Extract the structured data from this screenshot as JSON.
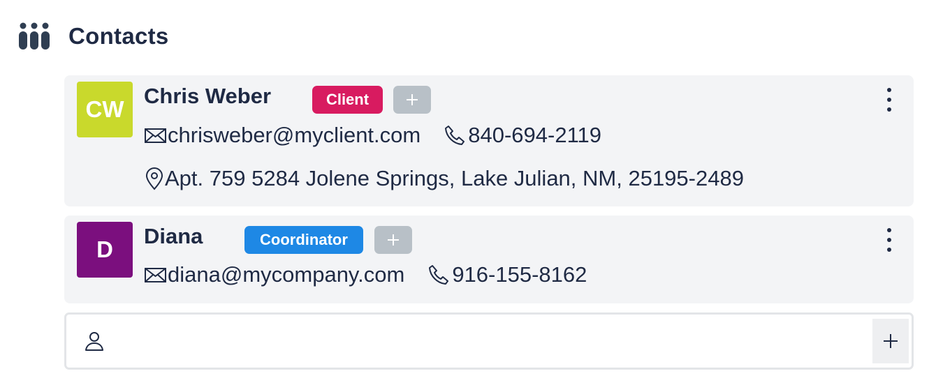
{
  "header": {
    "title": "Contacts",
    "icon": "people-group-icon"
  },
  "contacts": [
    {
      "initials": "CW",
      "avatar_color": "#c9d92c",
      "name": "Chris Weber",
      "tag": {
        "label": "Client",
        "color": "#d81b60"
      },
      "email": "chrisweber@myclient.com",
      "phone": "840-694-2119",
      "address": "Apt. 759 5284 Jolene Springs, Lake Julian, NM, 25195-2489"
    },
    {
      "initials": "D",
      "avatar_color": "#7b0f7e",
      "name": "Diana",
      "tag": {
        "label": "Coordinator",
        "color": "#1e88e5"
      },
      "email": "diana@mycompany.com",
      "phone": "916-155-8162"
    }
  ],
  "add_contact": {
    "user_icon": "user-icon",
    "add_icon": "plus-icon"
  },
  "colors": {
    "card_bg": "#f3f4f6",
    "text": "#1f2a44",
    "tag_add_bg": "#b8c0c7"
  }
}
